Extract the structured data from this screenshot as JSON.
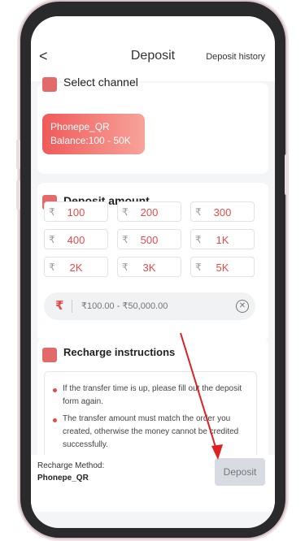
{
  "header": {
    "back_label": "<",
    "title": "Deposit",
    "history_label": "Deposit history"
  },
  "channel": {
    "title": "Select channel",
    "icon": "channel-icon",
    "option_name": "Phonepe_QR",
    "option_balance": "Balance:100 - 50K"
  },
  "amount": {
    "title": "Deposit amount",
    "icon": "wallet-icon",
    "currency_symbol": "₹",
    "options": [
      "100",
      "200",
      "300",
      "400",
      "500",
      "1K",
      "2K",
      "3K",
      "5K"
    ],
    "input_placeholder": "₹100.00 - ₹50,000.00",
    "input_value": ""
  },
  "instructions": {
    "title": "Recharge instructions",
    "icon": "book-icon",
    "items": [
      "If the transfer time is up, please fill out the deposit form again.",
      "The transfer amount must match the order you created, otherwise the money cannot be credited successfully."
    ]
  },
  "footer": {
    "method_label": "Recharge Method:",
    "method_value": "Phonepe_QR",
    "deposit_label": "Deposit"
  },
  "colors": {
    "accent": "#e34b4b",
    "pill_start": "#f05a5a",
    "pill_end": "#f7a39a",
    "disabled_button": "#d9dbe2"
  }
}
